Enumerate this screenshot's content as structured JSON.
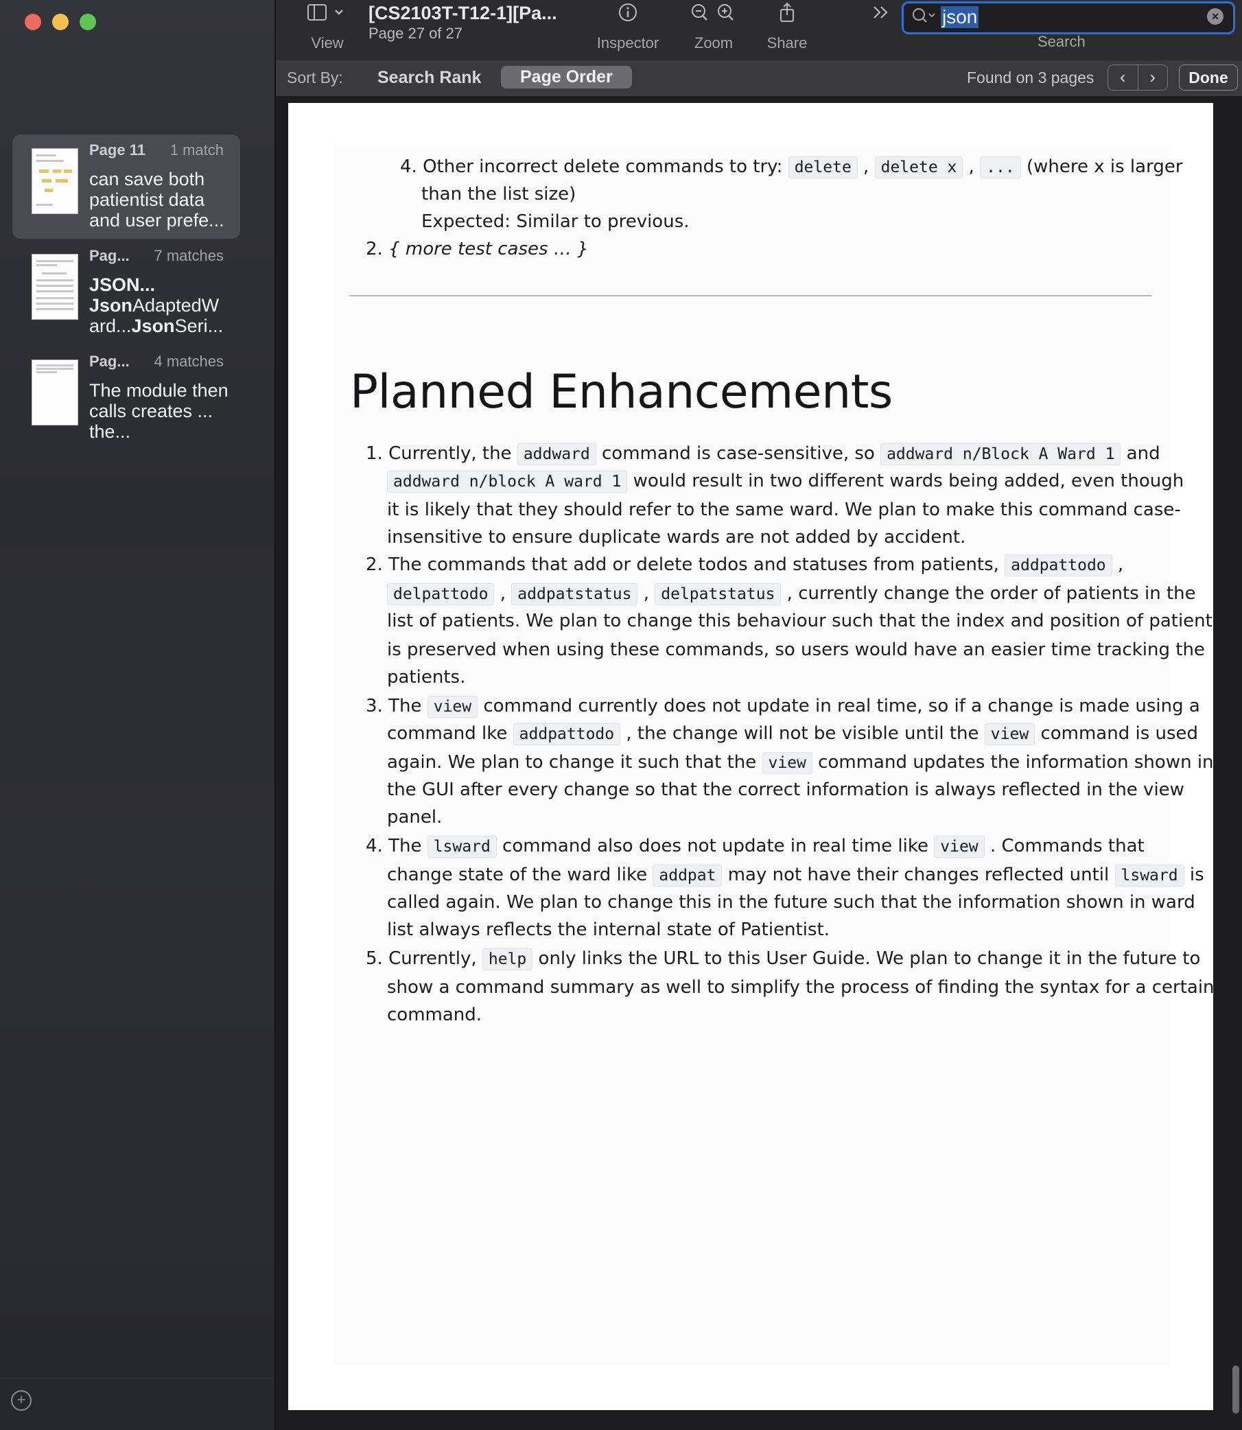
{
  "window": {
    "doc_title": "[CS2103T-T12-1][Pa...",
    "page_indicator": "Page 27 of 27"
  },
  "toolbar": {
    "view_label": "View",
    "inspector_label": "Inspector",
    "zoom_label": "Zoom",
    "share_label": "Share",
    "search_label": "Search",
    "search_value": "json"
  },
  "searchbar": {
    "sort_by": "Sort By:",
    "sort_rank": "Search Rank",
    "sort_order": "Page Order",
    "found": "Found on 3 pages",
    "done": "Done"
  },
  "results": [
    {
      "page": "Page 11",
      "matches": "1 match",
      "text": "can save both patientist data and user prefe..."
    },
    {
      "page": "Pag...",
      "matches": "7 matches",
      "text_parts": [
        "JSON...",
        "Json",
        "AdaptedW",
        "ard...",
        "Json",
        "Seri..."
      ]
    },
    {
      "page": "Pag...",
      "matches": "4 matches",
      "text": "The module then calls creates ... the..."
    }
  ],
  "document": {
    "item4": {
      "num": "4.",
      "pre": "Other incorrect delete commands to try: ",
      "c1": "delete",
      "sep1": " , ",
      "c2": "delete x",
      "sep2": " , ",
      "c3": "...",
      "post": " (where x is larger",
      "line2": "than the list size)",
      "line3": "Expected: Similar to previous."
    },
    "item2": {
      "num": "2.",
      "text": "{ more test cases … }"
    },
    "heading": "Planned Enhancements",
    "enh": {
      "e1": {
        "num": "1.",
        "l1a": "Currently, the ",
        "l1c1": "addward",
        "l1b": " command is case-sensitive, so ",
        "l1c2": "addward n/Block A Ward 1",
        "l1d": " and",
        "l2c": "addward n/block A ward 1",
        "l2b": " would result in two different wards being added, even though",
        "l3": "it is likely that they should refer to the same ward. We plan to make this command case-",
        "l4": "insensitive to ensure duplicate wards are not added by accident."
      },
      "e2": {
        "num": "2.",
        "l1a": "The commands that add or delete todos and statuses from patients, ",
        "l1c": "addpattodo",
        "l1b": " ,",
        "l2c1": "delpattodo",
        "l2s1": " , ",
        "l2c2": "addpatstatus",
        "l2s2": " , ",
        "l2c3": "delpatstatus",
        "l2b": " , currently change the order of patients in the",
        "l3": "list of patients. We plan to change this behaviour such that the index and position of patients",
        "l4": "is preserved when using these commands, so users would have an easier time tracking the",
        "l5": "patients."
      },
      "e3": {
        "num": "3.",
        "l1a": "The ",
        "l1c": "view",
        "l1b": " command currently does not update in real time, so if a change is made using a",
        "l2a": "command lke ",
        "l2c1": "addpattodo",
        "l2b": " , the change will not be visible until the ",
        "l2c2": "view",
        "l2d": " command is used",
        "l3a": "again. We plan to change it such that the ",
        "l3c": "view",
        "l3b": " command updates the information shown in",
        "l4": "the GUI after every change so that the correct information is always reflected in the view",
        "l5": "panel."
      },
      "e4": {
        "num": "4.",
        "l1a": "The ",
        "l1c1": "lsward",
        "l1b": " command also does not update in real time like ",
        "l1c2": "view",
        "l1d": " . Commands that",
        "l2a": "change state of the ward like ",
        "l2c1": "addpat",
        "l2b": " may not have their changes reflected until ",
        "l2c2": "lsward",
        "l2d": " is",
        "l3": "called again. We plan to change this in the future such that the information shown in ward",
        "l4": "list always reflects the internal state of Patientist."
      },
      "e5": {
        "num": "5.",
        "l1a": "Currently, ",
        "l1c": "help",
        "l1b": " only links the URL to this User Guide. We plan to change it in the future to",
        "l2": "show a command summary as well to simplify the process of finding the syntax for a certain",
        "l3": "command."
      }
    }
  }
}
